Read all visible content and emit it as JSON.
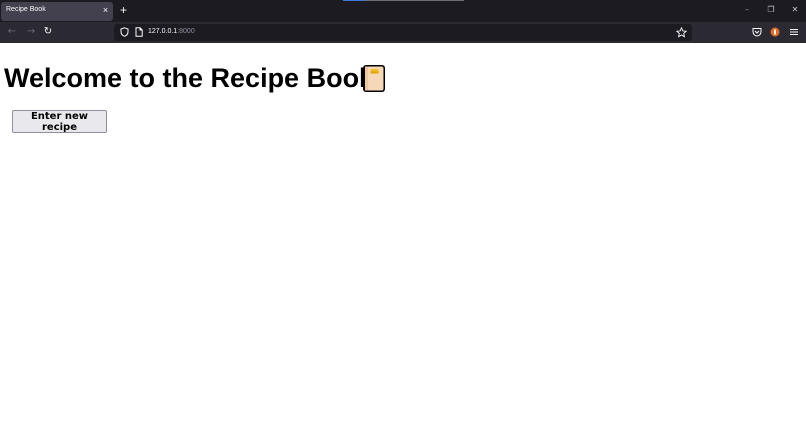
{
  "browser": {
    "tab_title": "Recipe Book",
    "tab_close_glyph": "×",
    "new_tab_glyph": "+",
    "url_host": "127.0.0.1",
    "url_port": ":8000",
    "window_controls": {
      "minimize": "–",
      "restore": "❐",
      "close": "✕"
    },
    "nav": {
      "back_glyph": "←",
      "forward_glyph": "→",
      "reload_glyph": "↻"
    },
    "colors": {
      "tabbar_bg": "#1c1b22",
      "active_tab_bg": "#42414d",
      "toolbar_bg": "#2b2a33",
      "urlbar_bg": "#1c1b22"
    }
  },
  "page": {
    "heading": "Welcome to the Recipe Book",
    "heading_icon": "notebook-emoji-icon",
    "enter_recipe_button": "Enter new recipe"
  }
}
